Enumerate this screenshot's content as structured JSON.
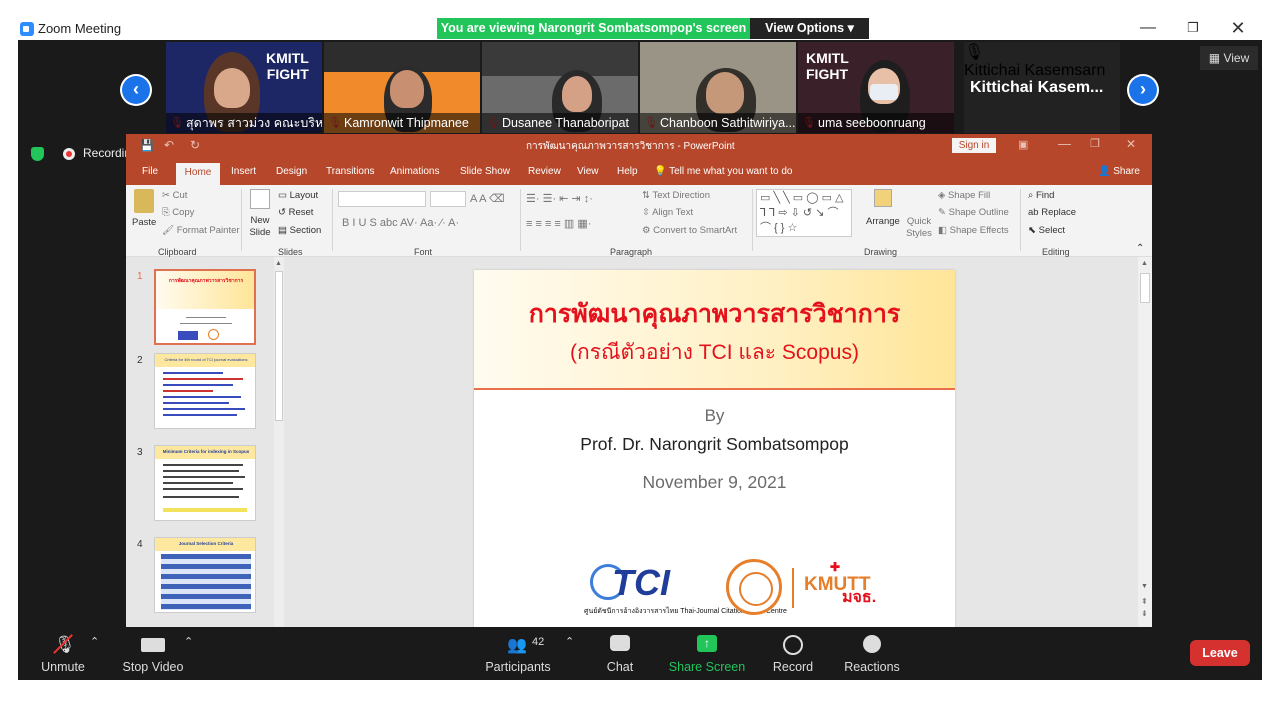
{
  "window": {
    "title": "Zoom Meeting",
    "banner": "You are viewing Narongrit Sombatsompop's screen",
    "view_options": "View Options"
  },
  "participants_strip": [
    {
      "name": "สุดาพร สาวม่วง คณะบริหา..."
    },
    {
      "name": "Kamronwit Thipmanee"
    },
    {
      "name": "Dusanee Thanaboripat"
    },
    {
      "name": "Chanboon Sathitwiriya..."
    },
    {
      "name": "uma seeboonruang"
    },
    {
      "name": "Kittichai Kasemsarn",
      "display_name": "Kittichai  Kasem..."
    }
  ],
  "view_button": "View",
  "recording": "Recording",
  "powerpoint": {
    "title": "การพัฒนาคุณภาพวารสารวิชาการ  -  PowerPoint",
    "sign_in": "Sign in",
    "share": "Share",
    "tabs": [
      "File",
      "Home",
      "Insert",
      "Design",
      "Transitions",
      "Animations",
      "Slide Show",
      "Review",
      "View",
      "Help"
    ],
    "tell_me": "Tell me what you want to do",
    "ribbon": {
      "paste": "Paste",
      "cut": "Cut",
      "copy": "Copy",
      "format_painter": "Format Painter",
      "clipboard": "Clipboard",
      "new_slide": "New Slide",
      "layout": "Layout",
      "reset": "Reset",
      "section": "Section",
      "slides": "Slides",
      "font": "Font",
      "text_direction": "Text Direction",
      "align_text": "Align Text",
      "convert_smartart": "Convert to SmartArt",
      "paragraph": "Paragraph",
      "arrange": "Arrange",
      "quick_styles": "Quick Styles",
      "shape_fill": "Shape Fill",
      "shape_outline": "Shape Outline",
      "shape_effects": "Shape Effects",
      "drawing": "Drawing",
      "find": "Find",
      "replace": "Replace",
      "select": "Select",
      "editing": "Editing"
    },
    "thumbnails": [
      {
        "num": "1",
        "title": "การพัฒนาคุณภาพวารสารวิชาการ"
      },
      {
        "num": "2",
        "title": "Criteria for 4th round of TCI journal evaluations"
      },
      {
        "num": "3",
        "title": "Minimum Criteria for indexing in Scopus"
      },
      {
        "num": "4",
        "title": "Journal Selection Criteria"
      }
    ],
    "slide": {
      "title": "การพัฒนาคุณภาพวารสารวิชาการ",
      "subtitle": "(กรณีตัวอย่าง TCI และ Scopus)",
      "by": "By",
      "author": "Prof. Dr. Narongrit Sombatsompop",
      "date": "November 9, 2021",
      "tci_logo_text": "TCI",
      "tci_caption": "ศูนย์ดัชนีการอ้างอิงวารสารไทย Thai-Journal Citation Index Centre",
      "kmutt_logo": "KMUTT",
      "kmutt_thai": "มจธ."
    }
  },
  "toolbar": {
    "unmute": "Unmute",
    "stop_video": "Stop Video",
    "participants": "Participants",
    "participants_count": "42",
    "chat": "Chat",
    "share_screen": "Share Screen",
    "record": "Record",
    "reactions": "Reactions",
    "leave": "Leave"
  },
  "colors": {
    "zoom_blue": "#2D8CFF",
    "banner_green": "#21C55A",
    "ppt_red": "#B7472A",
    "leave_red": "#D5312F",
    "slide_title_red": "#E3121D"
  }
}
